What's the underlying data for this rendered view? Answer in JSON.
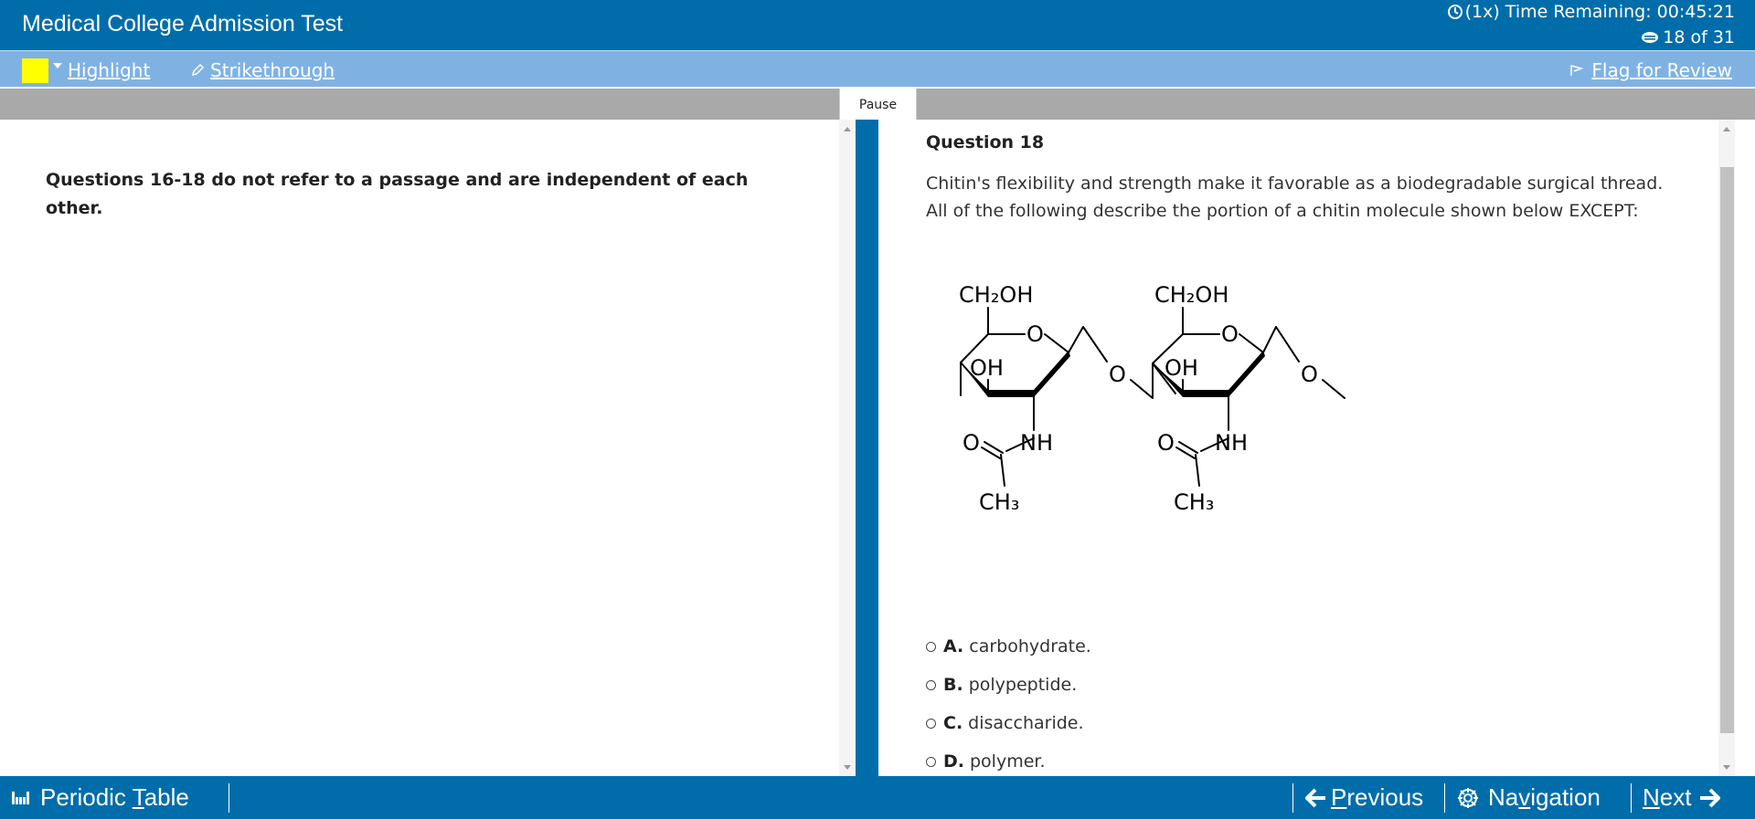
{
  "header": {
    "title": "Medical College Admission Test",
    "timer_text": "(1x) Time Remaining: 00:45:21",
    "question_count": "18 of 31"
  },
  "toolbar": {
    "highlight_label": "Highlight",
    "highlight_color": "#ffff00",
    "strikethrough_label": "Strikethrough",
    "flag_label": "Flag for Review"
  },
  "pause_label": "Pause",
  "passage": {
    "text": "Questions 16-18 do not refer to a passage and are independent of each other."
  },
  "question": {
    "number": "Question 18",
    "stem": "Chitin's flexibility and strength make it favorable as a biodegradable surgical thread. All of the following describe the portion of a chitin molecule shown below EXCEPT:",
    "figure": {
      "ring1": {
        "ch2oh": "CH₂OH",
        "ring_o": "O",
        "oh": "OH",
        "nh": "NH",
        "carbonyl_o": "O",
        "ch3": "CH₃"
      },
      "linkage_o": "O",
      "ring2": {
        "ch2oh": "CH₂OH",
        "ring_o": "O",
        "oh": "OH",
        "nh": "NH",
        "carbonyl_o": "O",
        "ch3": "CH₃"
      },
      "end_o": "O"
    },
    "choices": [
      {
        "letter": "A.",
        "text": "carbohydrate."
      },
      {
        "letter": "B.",
        "text": "polypeptide."
      },
      {
        "letter": "C.",
        "text": "disaccharide."
      },
      {
        "letter": "D.",
        "text": "polymer."
      }
    ]
  },
  "footer": {
    "periodic_label_pre": "Periodic ",
    "periodic_label_u": "T",
    "periodic_label_post": "able",
    "previous_label_u": "P",
    "previous_label_post": "revious",
    "navigation_label_pre": "Na",
    "navigation_label_u": "v",
    "navigation_label_post": "igation",
    "next_label_u": "N",
    "next_label_post": "ext"
  },
  "colors": {
    "brand_blue": "#006daa",
    "toolbar_blue": "#7fb2e3",
    "gray_bar": "#a9a9a9"
  }
}
